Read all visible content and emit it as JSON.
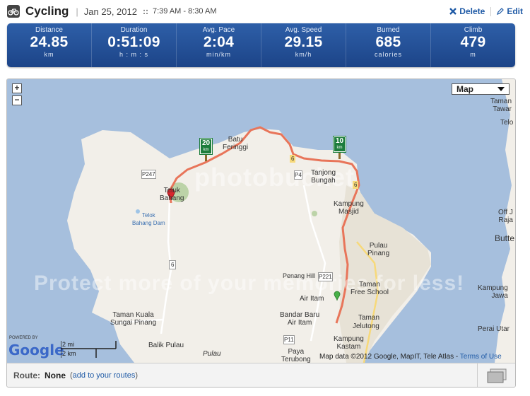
{
  "header": {
    "title": "Cycling",
    "date": "Jan 25, 2012",
    "date_separator": "::",
    "time_range": "7:39 AM - 8:30 AM",
    "delete_label": "Delete",
    "edit_label": "Edit"
  },
  "stats": [
    {
      "label": "Distance",
      "value": "24.85",
      "unit": "km"
    },
    {
      "label": "Duration",
      "value": "0:51:09",
      "unit": "h : m : s"
    },
    {
      "label": "Avg. Pace",
      "value": "2:04",
      "unit": "min/km"
    },
    {
      "label": "Avg. Speed",
      "value": "29.15",
      "unit": "km/h"
    },
    {
      "label": "Burned",
      "value": "685",
      "unit": "calories"
    },
    {
      "label": "Climb",
      "value": "479",
      "unit": "m"
    }
  ],
  "map": {
    "zoom_in": "+",
    "zoom_out": "−",
    "map_type": "Map",
    "labels": {
      "batu_ferringgi": "Batu\nFeringgi",
      "tanjong_bungah": "Tanjong\nBungah",
      "teluk_bahang": "Teluk\nBahang",
      "telok_bahang_dam": "Telok\nBahang Dam",
      "kampung_masjid": "Kampung\nMasjid",
      "pulau_pinang": "Pulau\nPinang",
      "penang_hill": "Penang Hill",
      "taman_free_school": "Taman\nFree School",
      "air_itam": "Air Itam",
      "bandar_baru_air_itam": "Bandar Baru\nAir Itam",
      "taman_kuala_sungai_pinang": "Taman Kuala\nSungai Pinang",
      "balik_pulau": "Balik Pulau",
      "pulau": "Pulau",
      "paya_terubong": "Paya\nTerubong",
      "jelutong": "Jelutong",
      "taman": "Taman",
      "kampung_kastam": "Kampung\nKastam",
      "taman_tawar": "Taman\nTawar",
      "telo": "Telo",
      "off_j_raja": "Off J\nRaja",
      "butte": "Butte",
      "kampung_jawa": "Kampung\nJawa",
      "perai_utar": "Perai Utar",
      "road_p247": "P247",
      "road_6a": "6",
      "road_6b": "6",
      "road_6c": "6",
      "road_p4": "P4",
      "road_p221": "P221",
      "road_p11": "P11"
    },
    "km_signs": [
      {
        "value": "20",
        "unit": "km"
      },
      {
        "value": "10",
        "unit": "km"
      }
    ],
    "watermark_top": "photobucket",
    "watermark_bottom": "Protect more of your memories for less!",
    "powered_by": "POWERED BY",
    "logo_text": "Google",
    "scale_mi": "2 mi",
    "scale_km": "2 km",
    "copyright": "Map data ©2012 Google, MapIT, Tele Atlas -",
    "terms": "Terms of Use",
    "colors": {
      "water": "#a6bfdd",
      "land": "#f2efe9",
      "route": "#e8755a",
      "sign": "#1d7d3c"
    }
  },
  "route_bar": {
    "label": "Route:",
    "name": "None",
    "link_prefix": "(",
    "link": "add to your routes",
    "link_suffix": ")"
  }
}
